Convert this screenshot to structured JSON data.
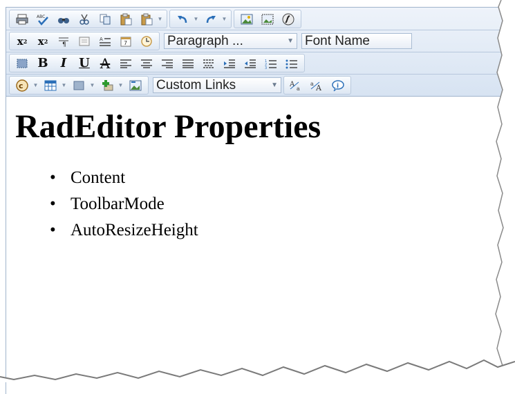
{
  "toolbar": {
    "row1": {
      "icons": [
        "print-icon",
        "spellcheck-icon",
        "find-icon",
        "cut-icon",
        "copy-icon",
        "paste-icon",
        "paste-special-icon",
        "undo-icon",
        "redo-icon",
        "image-manager-icon",
        "image-map-icon",
        "flash-icon"
      ],
      "spellcheck_label": "ABC"
    },
    "row2": {
      "paragraph_select": "Paragraph ...",
      "font_select": "Font Name"
    },
    "row3": {
      "bold": "B",
      "italic": "I",
      "underline": "U",
      "strike": "A"
    },
    "row4": {
      "custom_links_select": "Custom Links"
    }
  },
  "content": {
    "heading": "RadEditor Properties",
    "items": [
      "Content",
      "ToolbarMode",
      "AutoResizeHeight"
    ]
  },
  "colors": {
    "toolbar_bg_top": "#eef3fa",
    "toolbar_bg_bottom": "#d7e3f2",
    "border": "#9fb3cc",
    "icon_blue": "#2c4e78"
  }
}
